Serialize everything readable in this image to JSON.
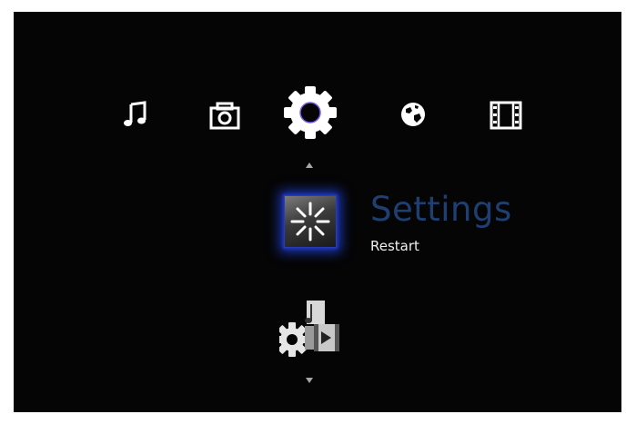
{
  "nav": {
    "items": [
      {
        "icon": "music-note-icon",
        "selected": false
      },
      {
        "icon": "camera-icon",
        "selected": false
      },
      {
        "icon": "gear-icon",
        "selected": true
      },
      {
        "icon": "globe-icon",
        "selected": false
      },
      {
        "icon": "film-icon",
        "selected": false
      }
    ]
  },
  "submenu": {
    "selected_title": "Settings",
    "selected_subtitle": "Restart",
    "selected_icon": "restart-icon",
    "next_icon": "media-settings-icon"
  },
  "colors": {
    "background": "#050505",
    "title": "#1f3e72",
    "highlight_glow": "#1c38be",
    "icon": "#ffffff"
  }
}
